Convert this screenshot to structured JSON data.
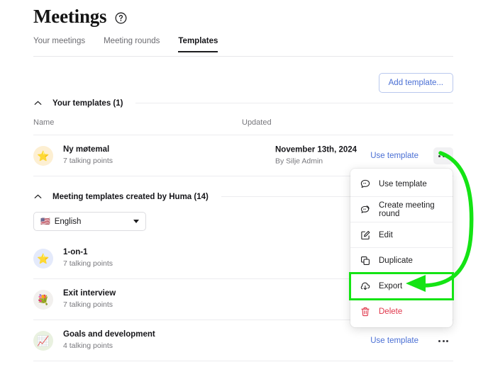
{
  "header": {
    "title": "Meetings",
    "help_icon": "question-circle-icon"
  },
  "tabs": [
    {
      "label": "Your meetings",
      "active": false
    },
    {
      "label": "Meeting rounds",
      "active": false
    },
    {
      "label": "Templates",
      "active": true
    }
  ],
  "toolbar": {
    "add_template_label": "Add template..."
  },
  "your_templates": {
    "section_title": "Your templates (1)",
    "columns": {
      "name": "Name",
      "updated": "Updated"
    },
    "rows": [
      {
        "emoji": "⭐",
        "emoji_name": "star-emoji",
        "emoji_bg": "#fdefd2",
        "name": "Ny møtemal",
        "talking_points": "7 talking points",
        "updated_date": "November 13th, 2024",
        "updated_by": "By Silje Admin",
        "use_template_label": "Use template"
      }
    ]
  },
  "huma_templates": {
    "section_title": "Meeting templates created by Huma (14)",
    "language": {
      "flag": "🇺🇸",
      "label": "English",
      "caret_icon": "chevron-down-icon"
    },
    "rows": [
      {
        "emoji": "⭐",
        "emoji_name": "star-emoji",
        "emoji_bg": "#e4eafb",
        "name": "1-on-1",
        "talking_points": "7 talking points"
      },
      {
        "emoji": "💐",
        "emoji_name": "bouquet-emoji",
        "emoji_bg": "#f2f0ee",
        "name": "Exit interview",
        "talking_points": "7 talking points"
      },
      {
        "emoji": "📈",
        "emoji_name": "chart-increasing-emoji",
        "emoji_bg": "#e9f1e0",
        "name": "Goals and development",
        "talking_points": "4 talking points",
        "use_template_label": "Use template"
      }
    ]
  },
  "context_menu": {
    "items": [
      {
        "label": "Use template",
        "icon": "chat-bubble-icon",
        "danger": false,
        "highlighted": false
      },
      {
        "label": "Create meeting round",
        "icon": "chat-bubble-stack-icon",
        "danger": false,
        "highlighted": false
      },
      {
        "label": "Edit",
        "icon": "pencil-square-icon",
        "danger": false,
        "highlighted": false
      },
      {
        "label": "Duplicate",
        "icon": "duplicate-squares-icon",
        "danger": false,
        "highlighted": false
      },
      {
        "label": "Export",
        "icon": "cloud-download-icon",
        "danger": false,
        "highlighted": true
      },
      {
        "label": "Delete",
        "icon": "trash-icon",
        "danger": true,
        "highlighted": false
      }
    ]
  },
  "annotation": {
    "color": "#14e414",
    "type": "curved-arrow-highlight"
  },
  "colors": {
    "link": "#4a6fd4",
    "danger": "#e0364a",
    "annotation_green": "#14e414",
    "text": "#16161a",
    "muted": "#77777c",
    "rule": "#ececef"
  }
}
